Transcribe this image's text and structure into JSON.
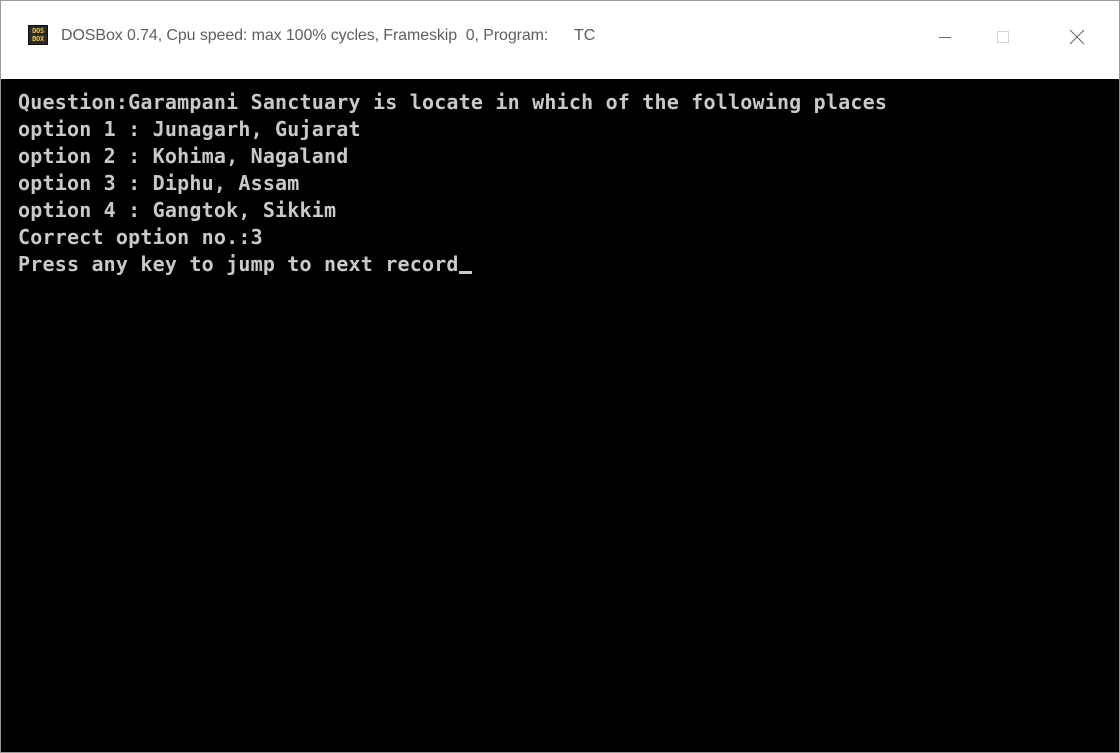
{
  "window": {
    "icon_text_top": "DOS",
    "icon_text_bottom": "BOX",
    "title_prefix": "DOSBox 0.74, Cpu speed: max 100% cycles, Frameskip  0, Program:",
    "title_program": "TC",
    "icon": "dosbox-icon",
    "controls": {
      "minimize": "minimize-icon",
      "maximize": "maximize-icon",
      "close": "close-icon"
    }
  },
  "terminal": {
    "background": "#000000",
    "text_color": "#c9c9c9",
    "lines": [
      "Question:Garampani Sanctuary is locate in which of the following places",
      "option 1 : Junagarh, Gujarat",
      "option 2 : Kohima, Nagaland",
      "option 3 : Diphu, Assam",
      "option 4 : Gangtok, Sikkim",
      "Correct option no.:3",
      "Press any key to jump to next record"
    ]
  }
}
